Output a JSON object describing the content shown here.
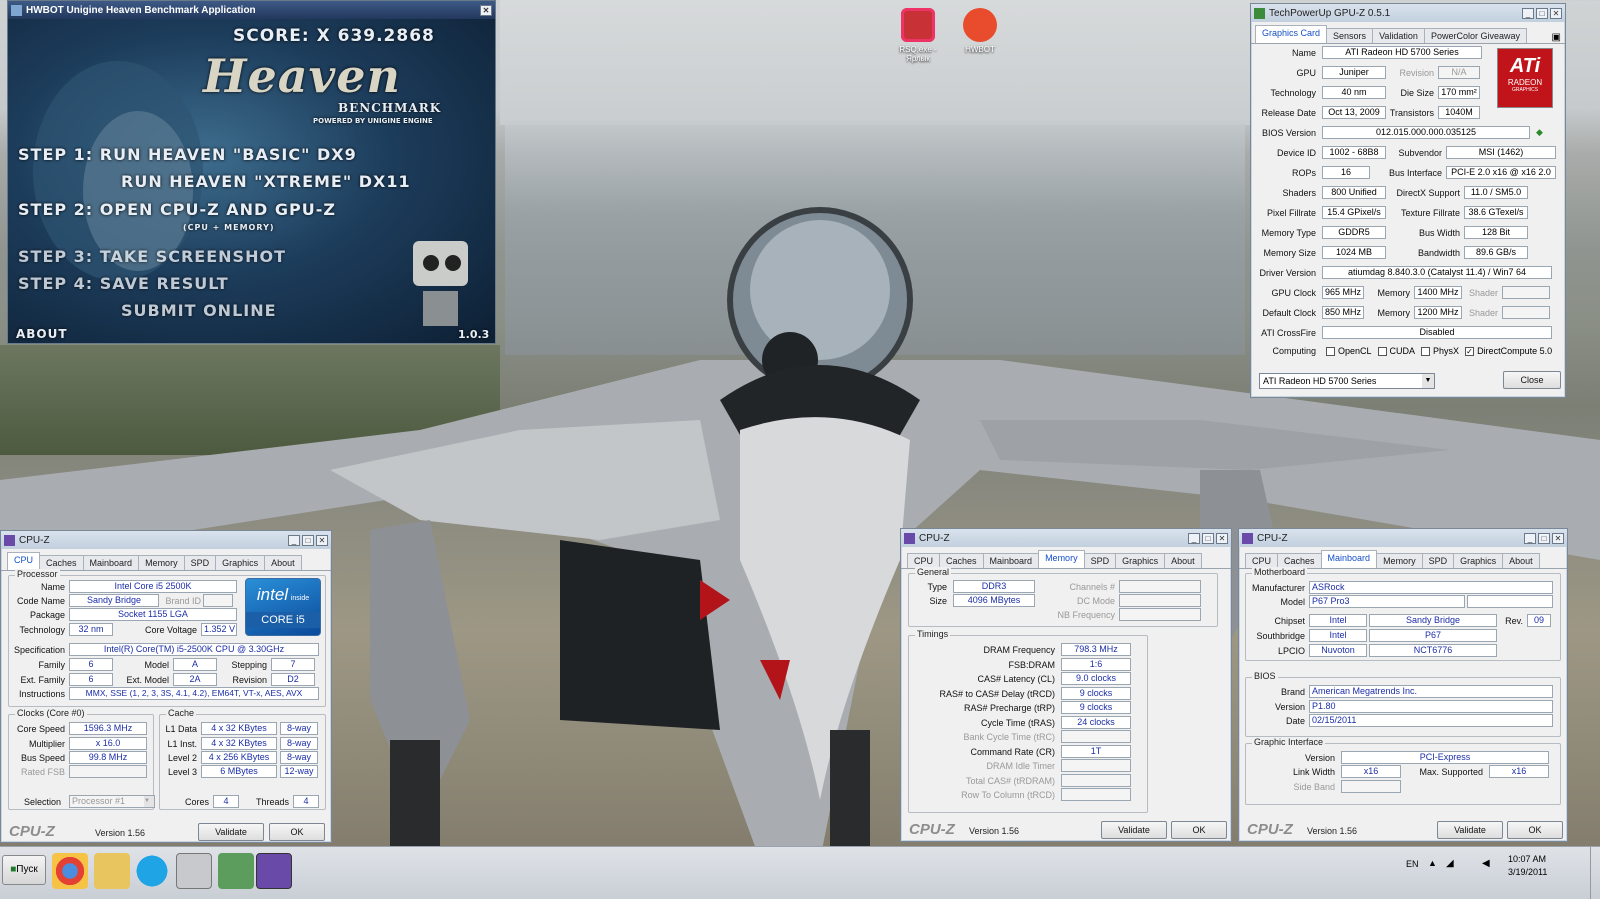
{
  "heaven": {
    "title": "HWBOT Unigine Heaven Benchmark Application",
    "score": "SCORE: X 639.2868",
    "logo": "Heaven",
    "subtitle": "BENCHMARK",
    "powered": "POWERED BY UNIGINE ENGINE",
    "step1a": "STEP 1:  RUN HEAVEN \"BASIC\" DX9",
    "step1b": "RUN HEAVEN \"XTREME\" DX11",
    "step2": "STEP 2: OPEN CPU-Z  AND  GPU-Z",
    "step2note": "(CPU + MEMORY)",
    "step3": "STEP 3: TAKE SCREENSHOT",
    "step4": "STEP 4: SAVE RESULT",
    "submit": "SUBMIT ONLINE",
    "about": "ABOUT",
    "version": "1.0.3"
  },
  "desktop": {
    "icon1": "RSQ.exe - Ярлык",
    "icon2": "HWBOT"
  },
  "gpuz": {
    "title": "TechPowerUp GPU-Z 0.5.1",
    "tabs": [
      "Graphics Card",
      "Sensors",
      "Validation",
      "PowerColor Giveaway"
    ],
    "name": "ATI Radeon HD 5700 Series",
    "gpu": "Juniper",
    "revision_label": "Revision",
    "revision": "N/A",
    "technology": "40 nm",
    "die_size_label": "Die Size",
    "die_size": "170 mm²",
    "release_date": "Oct 13, 2009",
    "transistors_label": "Transistors",
    "transistors": "1040M",
    "bios": "012.015.000.000.035125",
    "device_id": "1002 - 68B8",
    "subvendor_label": "Subvendor",
    "subvendor": "MSI (1462)",
    "rops": "16",
    "bus_label": "Bus Interface",
    "bus": "PCI-E 2.0 x16 @ x16 2.0",
    "shaders": "800 Unified",
    "dx_label": "DirectX Support",
    "dx": "11.0 / SM5.0",
    "pixel": "15.4 GPixel/s",
    "texture_label": "Texture Fillrate",
    "texture": "38.6 GTexel/s",
    "memtype": "GDDR5",
    "buswidth_label": "Bus Width",
    "buswidth": "128 Bit",
    "memsize": "1024 MB",
    "bandwidth_label": "Bandwidth",
    "bandwidth": "89.6 GB/s",
    "driver": "atiumdag 8.840.3.0 (Catalyst 11.4) / Win7 64",
    "gpuclock": "965 MHz",
    "mem_label": "Memory",
    "memclock": "1400 MHz",
    "shader_label": "Shader",
    "defclock": "850 MHz",
    "defmem": "1200 MHz",
    "crossfire": "Disabled",
    "opencl": "OpenCL",
    "cuda": "CUDA",
    "physx": "PhysX",
    "dc": "DirectCompute 5.0",
    "select": "ATI Radeon HD 5700 Series",
    "close": "Close",
    "labels": {
      "name": "Name",
      "gpu": "GPU",
      "technology": "Technology",
      "release": "Release Date",
      "bios": "BIOS Version",
      "device": "Device ID",
      "rops": "ROPs",
      "shaders": "Shaders",
      "pixel": "Pixel Fillrate",
      "memtype": "Memory Type",
      "memsize": "Memory Size",
      "driver": "Driver Version",
      "gpuclock": "GPU Clock",
      "defclock": "Default Clock",
      "crossfire": "ATI CrossFire",
      "computing": "Computing"
    },
    "logo": "ATi",
    "logo2": "RADEON",
    "logo3": "GRAPHICS"
  },
  "cpuz1": {
    "title": "CPU-Z",
    "tabs": [
      "CPU",
      "Caches",
      "Mainboard",
      "Memory",
      "SPD",
      "Graphics",
      "About"
    ],
    "group_processor": "Processor",
    "name_l": "Name",
    "name": "Intel Core i5 2500K",
    "code_l": "Code Name",
    "code": "Sandy Bridge",
    "brand_l": "Brand ID",
    "pkg_l": "Package",
    "pkg": "Socket 1155 LGA",
    "tech_l": "Technology",
    "tech": "32 nm",
    "cv_l": "Core Voltage",
    "cv": "1.352 V",
    "spec_l": "Specification",
    "spec": "Intel(R) Core(TM) i5-2500K CPU @ 3.30GHz",
    "fam_l": "Family",
    "fam": "6",
    "model_l": "Model",
    "model": "A",
    "step_l": "Stepping",
    "step": "7",
    "efam_l": "Ext. Family",
    "efam": "6",
    "emodel_l": "Ext. Model",
    "emodel": "2A",
    "rev_l": "Revision",
    "rev": "D2",
    "instr_l": "Instructions",
    "instr": "MMX, SSE (1, 2, 3, 3S, 4.1, 4.2), EM64T, VT-x, AES, AVX",
    "group_clocks": "Clocks (Core #0)",
    "cs_l": "Core Speed",
    "cs": "1596.3 MHz",
    "mul_l": "Multiplier",
    "mul": "x 16.0",
    "bus_l": "Bus Speed",
    "bus": "99.8 MHz",
    "rfsb_l": "Rated FSB",
    "group_cache": "Cache",
    "l1d_l": "L1 Data",
    "l1d": "4 x 32 KBytes",
    "l1d_w": "8-way",
    "l1i_l": "L1 Inst.",
    "l1i": "4 x 32 KBytes",
    "l1i_w": "8-way",
    "l2_l": "Level 2",
    "l2": "4 x 256 KBytes",
    "l2_w": "8-way",
    "l3_l": "Level 3",
    "l3": "6 MBytes",
    "l3_w": "12-way",
    "sel_l": "Selection",
    "sel": "Processor #1",
    "cores_l": "Cores",
    "cores": "4",
    "threads_l": "Threads",
    "threads": "4",
    "logo": "CPU-Z",
    "version": "Version 1.56",
    "validate": "Validate",
    "ok": "OK",
    "intel1": "intel",
    "intel2": "inside",
    "intel3": "CORE i5"
  },
  "cpuz2": {
    "title": "CPU-Z",
    "tabs": [
      "CPU",
      "Caches",
      "Mainboard",
      "Memory",
      "SPD",
      "Graphics",
      "About"
    ],
    "group_general": "General",
    "type_l": "Type",
    "type": "DDR3",
    "ch_l": "Channels #",
    "size_l": "Size",
    "size": "4096 MBytes",
    "dc_l": "DC Mode",
    "nb_l": "NB Frequency",
    "group_timings": "Timings",
    "dram_l": "DRAM Frequency",
    "dram": "798.3 MHz",
    "fsb_l": "FSB:DRAM",
    "fsb": "1:6",
    "cl_l": "CAS# Latency (CL)",
    "cl": "9.0 clocks",
    "trcd_l": "RAS# to CAS# Delay (tRCD)",
    "trcd": "9 clocks",
    "trp_l": "RAS# Precharge (tRP)",
    "trp": "9 clocks",
    "tras_l": "Cycle Time (tRAS)",
    "tras": "24 clocks",
    "bct_l": "Bank Cycle Time (tRC)",
    "cr_l": "Command Rate (CR)",
    "cr": "1T",
    "idle_l": "DRAM Idle Timer",
    "tcas_l": "Total CAS# (tRDRAM)",
    "rtc_l": "Row To Column (tRCD)",
    "logo": "CPU-Z",
    "version": "Version 1.56",
    "validate": "Validate",
    "ok": "OK"
  },
  "cpuz3": {
    "title": "CPU-Z",
    "tabs": [
      "CPU",
      "Caches",
      "Mainboard",
      "Memory",
      "SPD",
      "Graphics",
      "About"
    ],
    "group_mb": "Motherboard",
    "man_l": "Manufacturer",
    "man": "ASRock",
    "model_l": "Model",
    "model": "P67 Pro3",
    "chip_l": "Chipset",
    "chip": "Intel",
    "chip2": "Sandy Bridge",
    "rev_l": "Rev.",
    "rev": "09",
    "sb_l": "Southbridge",
    "sb": "Intel",
    "sb2": "P67",
    "lpc_l": "LPCIO",
    "lpc": "Nuvoton",
    "lpc2": "NCT6776",
    "group_bios": "BIOS",
    "brand_l": "Brand",
    "brand": "American Megatrends Inc.",
    "ver_l": "Version",
    "ver": "P1.80",
    "date_l": "Date",
    "date": "02/15/2011",
    "group_gi": "Graphic Interface",
    "giv_l": "Version",
    "giv": "PCI-Express",
    "lw_l": "Link Width",
    "lw": "x16",
    "ms_l": "Max. Supported",
    "ms": "x16",
    "sb_band_l": "Side Band",
    "logo": "CPU-Z",
    "version": "Version 1.56",
    "validate": "Validate",
    "ok": "OK"
  },
  "taskbar": {
    "start": "Пуск",
    "lang": "EN",
    "time": "10:07 AM",
    "date": "3/19/2011"
  }
}
